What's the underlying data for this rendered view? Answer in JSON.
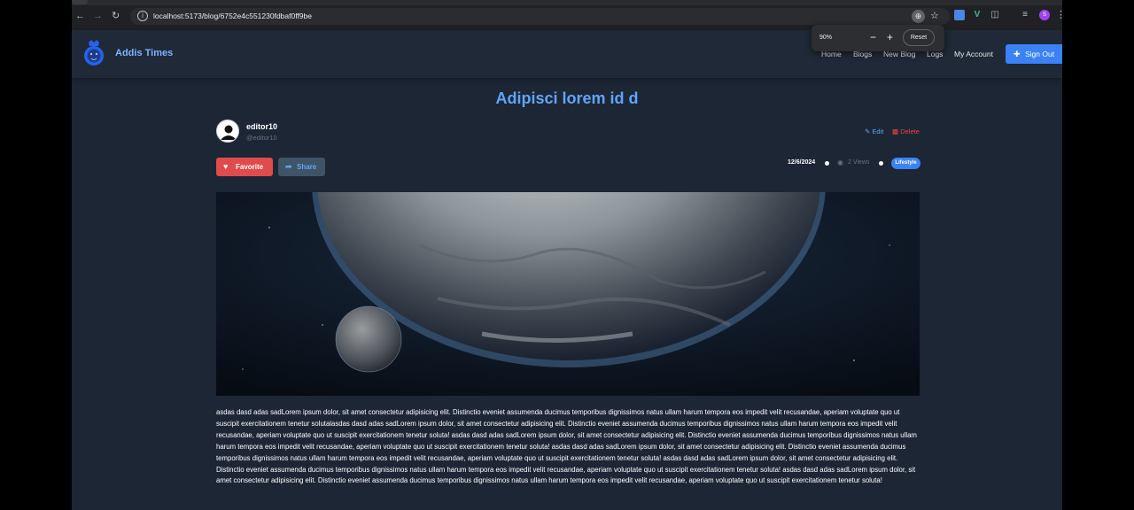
{
  "browser": {
    "url": "localhost:5173/blog/6752e4c551230fdbaf0ff9be",
    "zoom_percent": "90%",
    "zoom_reset_label": "Reset",
    "profile_initial": "S"
  },
  "header": {
    "brand": "Addis Times",
    "nav": [
      "Home",
      "Blogs",
      "New Blog",
      "Logs",
      "My Account"
    ],
    "signout_label": "Sign Out"
  },
  "post": {
    "title": "Adipisci lorem id d",
    "author": "editor10",
    "handle": "@editor10",
    "edit_label": "Edit",
    "delete_label": "Delete",
    "favorite_label": "Favorite",
    "share_label": "Share",
    "date": "12/6/2024",
    "views": "2 Views",
    "category": "Lifestyle",
    "body": "asdas dasd adas sadLorem ipsum dolor, sit amet consectetur adipisicing elit. Distinctio eveniet assumenda ducimus temporibus dignissimos natus ullam harum tempora eos impedit velit recusandae, aperiam voluptate quo ut suscipit exercitationem tenetur solutalasdas dasd adas sadLorem ipsum dolor, sit amet consectetur adipisicing elit. Distinctio eveniet assumenda ducimus temporibus dignissimos natus ullam harum tempora eos impedit velit recusandae, aperiam voluptate quo ut suscipit exercitationem tenetur soluta! asdas dasd adas sadLorem ipsum dolor, sit amet consectetur adipisicing elit. Distinctio eveniet assumenda ducimus temporibus dignissimos natus ullam harum tempora eos impedit velit recusandae, aperiam voluptate quo ut suscipit exercitationem tenetur soluta! asdas dasd adas sadLorem ipsum dolor, sit amet consectetur adipisicing elit. Distinctio eveniet assumenda ducimus temporibus dignissimos natus ullam harum tempora eos impedit velit recusandae, aperiam voluptate quo ut suscipit exercitationem tenetur soluta! asdas dasd adas sadLorem ipsum dolor, sit amet consectetur adipisicing elit. Distinctio eveniet assumenda ducimus temporibus dignissimos natus ullam harum tempora eos impedit velit recusandae, aperiam voluptate quo ut suscipit exercitationem tenetur soluta! asdas dasd adas sadLorem ipsum dolor, sit amet consectetur adipisicing elit. Distinctio eveniet assumenda ducimus temporibus dignissimos natus ullam harum tempora eos impedit velit recusandae, aperiam voluptate quo ut suscipit exercitationem tenetur soluta!"
  },
  "icons": {
    "back": "arrow-left-icon",
    "forward": "arrow-right-icon",
    "reload": "reload-icon",
    "site_info": "info-icon",
    "zoom": "zoom-icon",
    "bookmark": "star-icon",
    "logo": "lion-logo",
    "edit": "pencil-square-icon",
    "delete": "trash-icon",
    "favorite": "heart-icon",
    "share": "share-arrow-icon",
    "views": "eye-icon",
    "signout": "user-plus-icon"
  },
  "colors": {
    "page_bg": "#1c2634",
    "header_bg": "#1f2937",
    "accent": "#60a5fa",
    "primary_button": "#3b82f6",
    "danger": "#e04b4b"
  }
}
